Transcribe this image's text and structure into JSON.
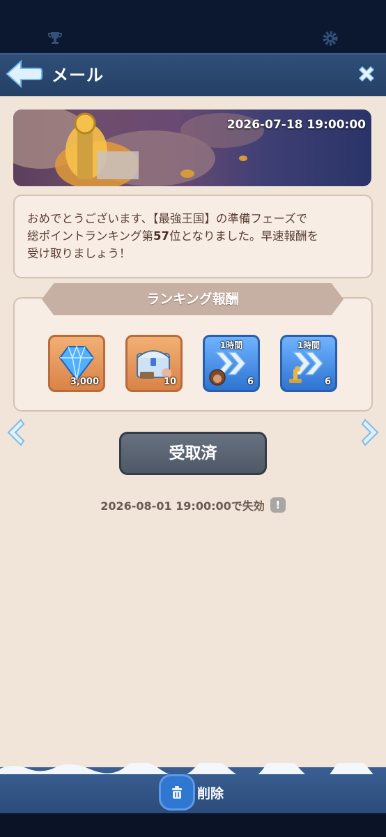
{
  "header": {
    "title": "メール"
  },
  "banner": {
    "date": "2026-07-18 19:00:00"
  },
  "message": {
    "line1": "おめでとうございます、【最強王国】の準備フェーズで",
    "line2_prefix": "総ポイントランキング第",
    "rank": "57",
    "line2_suffix": "位となりました。早速報酬を",
    "line3": "受け取りましょう！"
  },
  "rewards": {
    "title": "ランキング報酬",
    "items": [
      {
        "icon": "diamond-icon",
        "label": "",
        "quantity": "3,000"
      },
      {
        "icon": "treasure-chest-icon",
        "label": "",
        "quantity": "10"
      },
      {
        "icon": "speedup-icon",
        "label": "1時間",
        "quantity": "6"
      },
      {
        "icon": "speedup-icon",
        "label": "1時間",
        "quantity": "6"
      }
    ]
  },
  "claim_button": {
    "label": "受取済"
  },
  "expiry": {
    "text": "2026-08-01 19:00:00で失効",
    "info": "!"
  },
  "footer": {
    "delete_label": "削除"
  },
  "colors": {
    "panel": "#f1e4d8",
    "header": "#2f4f79",
    "button": "#5c6573",
    "accent": "#2f77d0"
  }
}
